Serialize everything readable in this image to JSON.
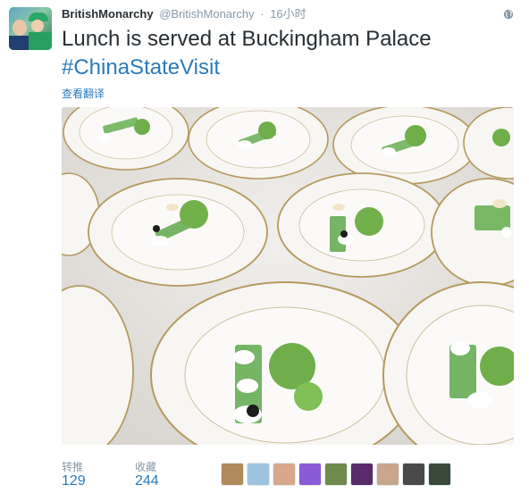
{
  "tweet": {
    "full_name": "BritishMonarchy",
    "screen_name": "@BritishMonarchy",
    "separator": "·",
    "time": "16小时",
    "text_line1": "Lunch is served at Buckingham Palace",
    "hashtag": "#ChinaStateVisit",
    "translate_label": "查看翻译"
  },
  "stats": {
    "retweets_label": "转推",
    "retweets_count": "129",
    "likes_label": "收藏",
    "likes_count": "244"
  },
  "icons": {
    "globe": "globe-icon"
  },
  "colors": {
    "link": "#2b7bb9",
    "meta": "#8899a6",
    "text": "#292f33"
  },
  "retweeter_avatars": [
    {
      "color": "#b08a5a"
    },
    {
      "color": "#9ec3e0"
    },
    {
      "color": "#d9a78b"
    },
    {
      "color": "#8a5bd6"
    },
    {
      "color": "#6f8a4b"
    },
    {
      "color": "#5a2a6a"
    },
    {
      "color": "#c9a58c"
    },
    {
      "color": "#4a4a4a"
    },
    {
      "color": "#3a4a3a"
    }
  ]
}
